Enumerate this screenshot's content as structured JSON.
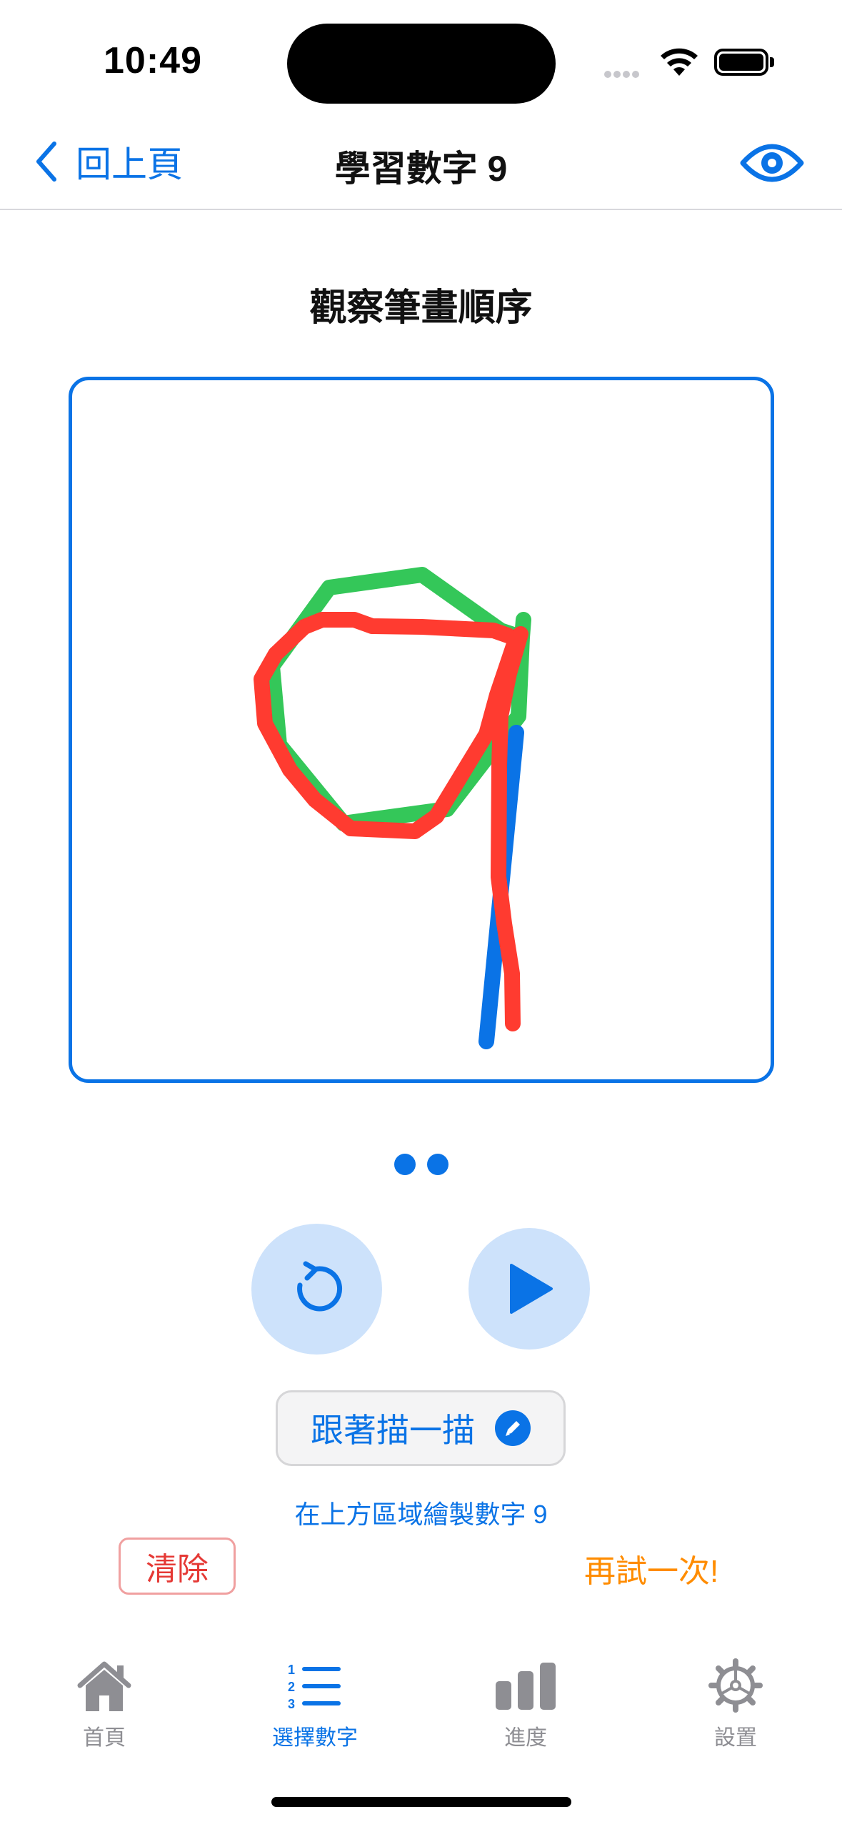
{
  "status_bar": {
    "time": "10:49"
  },
  "nav": {
    "back_label": "回上頁",
    "title": "學習數字 9"
  },
  "section_title": "觀察筆畫順序",
  "trace_button_label": "跟著描一描",
  "hint_text": "在上方區域繪製數字 9",
  "clear_label": "清除",
  "retry_label": "再試一次!",
  "page_dots": 2,
  "tabs": [
    {
      "label": "首頁",
      "icon": "house-icon",
      "active": false
    },
    {
      "label": "選擇數字",
      "icon": "numbered-list-icon",
      "active": true
    },
    {
      "label": "進度",
      "icon": "bar-chart-icon",
      "active": false
    },
    {
      "label": "設置",
      "icon": "gear-icon",
      "active": false
    }
  ],
  "colors": {
    "accent": "#0a73e6",
    "guide_loop": "#34c759",
    "guide_stem": "#0a73e6",
    "user_stroke": "#ff3b30",
    "retry": "#ff8c00",
    "clear": "#e53935"
  }
}
